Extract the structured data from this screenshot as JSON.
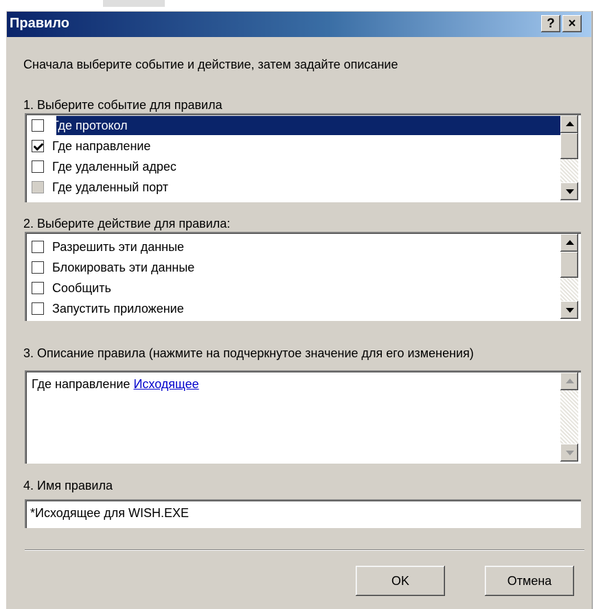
{
  "window": {
    "title": "Правило",
    "help_button": "?",
    "close_button": "×"
  },
  "intro_text": "Сначала выберите событие и действие, затем задайте описание",
  "events": {
    "label": "1. Выберите событие для правила",
    "items": [
      {
        "label": "Где протокол",
        "checked": false,
        "selected": true,
        "disabled": false
      },
      {
        "label": "Где направление",
        "checked": true,
        "selected": false,
        "disabled": false
      },
      {
        "label": "Где удаленный адрес",
        "checked": false,
        "selected": false,
        "disabled": false
      },
      {
        "label": "Где удаленный порт",
        "checked": false,
        "selected": false,
        "disabled": true
      }
    ]
  },
  "actions": {
    "label": "2. Выберите действие для правила:",
    "items": [
      {
        "label": "Разрешить эти данные",
        "checked": false
      },
      {
        "label": "Блокировать эти данные",
        "checked": false
      },
      {
        "label": "Сообщить",
        "checked": false
      },
      {
        "label": "Запустить приложение",
        "checked": false
      }
    ]
  },
  "description": {
    "label": "3. Описание правила (нажмите на подчеркнутое значение для его изменения)",
    "prefix": "Где направление ",
    "link": "Исходящее"
  },
  "rule_name": {
    "label": "4. Имя правила",
    "value": "*Исходящее для WISH.EXE"
  },
  "buttons": {
    "ok": "OK",
    "cancel": "Отмена"
  },
  "colors": {
    "face": "#d4d0c8",
    "title_start": "#0a246a",
    "selection": "#0a246a",
    "link": "#0000cc"
  }
}
